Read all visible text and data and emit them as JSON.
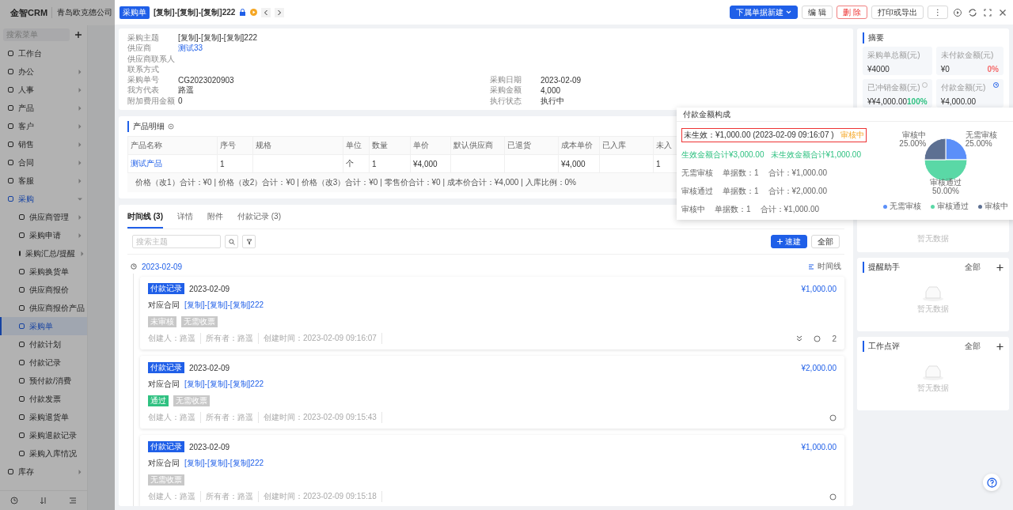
{
  "app_header": {
    "logo": "金智CRM",
    "company": "青岛欧克德公司"
  },
  "sidebar": {
    "search_placeholder": "搜索菜单",
    "items": [
      {
        "label": "工作台",
        "kind": "leaf",
        "selected": false
      },
      {
        "label": "办公",
        "kind": "group",
        "expanded": false,
        "selected": false
      },
      {
        "label": "人事",
        "kind": "group",
        "expanded": false,
        "selected": false
      },
      {
        "label": "产品",
        "kind": "group",
        "expanded": false,
        "selected": false
      },
      {
        "label": "客户",
        "kind": "group",
        "expanded": false,
        "selected": false
      },
      {
        "label": "销售",
        "kind": "group",
        "expanded": false,
        "selected": false
      },
      {
        "label": "合同",
        "kind": "group",
        "expanded": false,
        "selected": false
      },
      {
        "label": "客服",
        "kind": "group",
        "expanded": false,
        "selected": false
      },
      {
        "label": "采购",
        "kind": "group",
        "expanded": true,
        "selected": true,
        "children": [
          {
            "label": "供应商管理",
            "kind": "group",
            "expanded": false,
            "selected": false
          },
          {
            "label": "采购申请",
            "kind": "group",
            "expanded": false,
            "selected": false
          },
          {
            "label": "采购汇总/提醒",
            "kind": "group",
            "expanded": false,
            "selected": false
          },
          {
            "label": "采购换货单",
            "kind": "leaf",
            "selected": false
          },
          {
            "label": "供应商报价",
            "kind": "leaf",
            "selected": false
          },
          {
            "label": "供应商报价产品",
            "kind": "leaf",
            "selected": false
          },
          {
            "label": "采购单",
            "kind": "leaf",
            "selected": true
          },
          {
            "label": "付款计划",
            "kind": "leaf",
            "selected": false
          },
          {
            "label": "付款记录",
            "kind": "leaf",
            "selected": false
          },
          {
            "label": "预付款/消费",
            "kind": "leaf",
            "selected": false
          },
          {
            "label": "付款发票",
            "kind": "leaf",
            "selected": false
          },
          {
            "label": "采购退货单",
            "kind": "leaf",
            "selected": false
          },
          {
            "label": "采购退款记录",
            "kind": "leaf",
            "selected": false
          },
          {
            "label": "采购入库情况",
            "kind": "leaf",
            "selected": false
          }
        ]
      },
      {
        "label": "库存",
        "kind": "group",
        "expanded": false,
        "selected": false
      }
    ]
  },
  "drawer": {
    "tag": "采购单",
    "title": "[复制]-[复制]-[复制]222",
    "buttons": [
      {
        "label": "下属单据新建",
        "kind": "primary"
      },
      {
        "label": "编 辑",
        "kind": "default"
      },
      {
        "label": "删 除",
        "kind": "danger"
      },
      {
        "label": "打印或导出",
        "kind": "default"
      },
      {
        "label": "⋮",
        "kind": "default"
      }
    ]
  },
  "info": {
    "left": [
      {
        "label": "采购主题",
        "value": "[复制]-[复制]-[复制]222",
        "kind": "text"
      },
      {
        "label": "供应商",
        "value": "测试33",
        "kind": "link"
      },
      {
        "label": "供应商联系人"
      },
      {
        "label": "联系方式"
      },
      {
        "label": "采购单号",
        "value": "CG2023020903",
        "kind": "text"
      },
      {
        "label": "我方代表",
        "value": "路遥",
        "kind": "text"
      },
      {
        "label": "附加费用金额",
        "value": "0",
        "kind": "text"
      }
    ],
    "right": [
      {
        "label": "采购日期",
        "value": "2023-02-09"
      },
      {
        "label": "采购金额",
        "value": "4,000"
      },
      {
        "label": "执行状态",
        "value": "执行中"
      }
    ]
  },
  "products": {
    "title": "产品明细",
    "columns": [
      "产品名称",
      "序号",
      "规格",
      "单位",
      "数量",
      "单价",
      "默认供应商",
      "已退货",
      "成本单价",
      "已入库",
      "未入"
    ],
    "rows": [
      [
        "测试产品",
        "1",
        "",
        "个",
        "1",
        "¥4,000",
        "",
        "",
        "¥4,000",
        "",
        "1"
      ]
    ],
    "summary": "价格（改1）合计：¥0 |  价格（改2）合计：¥0 |  价格（改3）合计：¥0 |  零售价合计：¥0 |  成本价合计：¥4,000 |  入库比例：0%"
  },
  "timeline": {
    "tabs": [
      {
        "label": "时间线 (3)",
        "selected": true
      },
      {
        "label": "详情",
        "selected": false
      },
      {
        "label": "附件",
        "selected": false
      },
      {
        "label": "付款记录 (3)",
        "selected": false
      }
    ],
    "search_placeholder": "搜索主题",
    "quick_create": "速建",
    "filter_all": "全部",
    "date": "2023-02-09",
    "view_toggle": "时间线",
    "entries": [
      {
        "tag": "付款记录",
        "date": "2023-02-09",
        "contract_label": "对应合同",
        "contract": "[复制]-[复制]-[复制]222",
        "amount": "¥1,000.00",
        "badges": [
          {
            "label": "未审核",
            "kind": "grey"
          },
          {
            "label": "无需收票",
            "kind": "grey"
          }
        ],
        "meta": [
          "创建人：路遥",
          "所有者：路遥",
          "创建时间：2023-02-09 09:16:07"
        ],
        "comments": "2",
        "expandable": true
      },
      {
        "tag": "付款记录",
        "date": "2023-02-09",
        "contract_label": "对应合同",
        "contract": "[复制]-[复制]-[复制]222",
        "amount": "¥2,000.00",
        "badges": [
          {
            "label": "通过",
            "kind": "green"
          },
          {
            "label": "无需收票",
            "kind": "grey"
          }
        ],
        "meta": [
          "创建人：路遥",
          "所有者：路遥",
          "创建时间：2023-02-09 09:15:43"
        ],
        "expandable": false
      },
      {
        "tag": "付款记录",
        "date": "2023-02-09",
        "contract_label": "对应合同",
        "contract": "[复制]-[复制]-[复制]222",
        "amount": "¥1,000.00",
        "badges": [
          {
            "label": "无需收票",
            "kind": "grey"
          }
        ],
        "meta": [
          "创建人：路遥",
          "所有者：路遥",
          "创建时间：2023-02-09 09:15:18"
        ],
        "expandable": false
      }
    ]
  },
  "summary_panel": {
    "title": "摘要",
    "stats": [
      {
        "label": "采购单总额(元)",
        "value": "¥4000",
        "kind": "plain"
      },
      {
        "label": "未付款金额(元)",
        "value": "¥0",
        "percent": "0%",
        "color": "#f56c6c",
        "kind": "plain"
      },
      {
        "label": "已冲销金额(元)",
        "value": "¥¥4,000.00",
        "percent": "100%",
        "color": "#2fc181",
        "kind": "info"
      },
      {
        "label": "付款金额(元)",
        "value": "¥4,000.00",
        "kind": "link"
      }
    ]
  },
  "empty_text": "暂无数据",
  "side_cards": [
    {
      "title": "提醒助手",
      "filter": "全部",
      "empty": "暂无数据"
    },
    {
      "title": "工作点评",
      "filter": "全部",
      "empty": "暂无数据"
    }
  ],
  "popup": {
    "title": "付款金额构成",
    "highlight": {
      "text": "未生效：¥1,000.00 (2023-02-09 09:16:07 )",
      "status": "审核中"
    },
    "totals": [
      "生效金额合计¥3,000.00",
      "未生效金额合计¥1,000.00"
    ],
    "rows": [
      {
        "status": "无需审核",
        "count": "单据数：1",
        "total": "合计：¥1,000.00"
      },
      {
        "status": "审核通过",
        "count": "单据数：1",
        "total": "合计：¥2,000.00"
      },
      {
        "status": "审核中",
        "count": "单据数：1",
        "total": "合计：¥1,000.00"
      }
    ],
    "chart_data": {
      "type": "pie",
      "categories": [
        "无需审核",
        "审核通过",
        "审核中"
      ],
      "values": [
        25,
        50,
        25
      ],
      "value_labels": [
        "25.00%",
        "50.00%",
        "25.00%"
      ]
    }
  }
}
